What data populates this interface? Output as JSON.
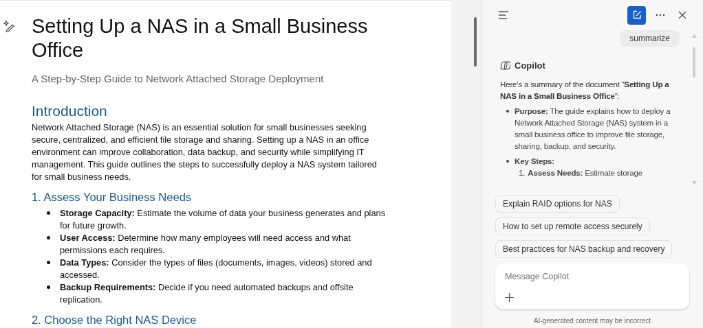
{
  "document": {
    "title": "Setting Up a NAS in a Small Business Office",
    "subtitle": "A Step-by-Step Guide to Network Attached Storage Deployment",
    "sections": [
      {
        "heading": "Introduction",
        "kind": "h1",
        "paragraph": "Network Attached Storage (NAS) is an essential solution for small businesses seeking secure, centralized, and efficient file storage and sharing. Setting up a NAS in an office environment can improve collaboration, data backup, and security while simplifying IT management. This guide outlines the steps to successfully deploy a NAS system tailored for small business needs."
      },
      {
        "heading": "1. Assess Your Business Needs",
        "kind": "h2",
        "bullets": [
          "**Storage Capacity:** Estimate the volume of data your business generates and plans for future growth.",
          "**User Access:** Determine how many employees will need access and what permissions each requires.",
          "**Data Types:** Consider the types of files (documents, images, videos) stored and accessed.",
          "**Backup Requirements:** Decide if you need automated backups and offsite replication."
        ]
      },
      {
        "heading": "2. Choose the Right NAS Device",
        "kind": "h2"
      }
    ]
  },
  "copilot": {
    "user_message": "summarize",
    "assistant_name": "Copilot",
    "summary_intro": "Here's a summary of the document “**Setting Up a NAS in a Small Business Office**”:",
    "summary_points": [
      {
        "text": "**Purpose:** The guide explains how to deploy a Network Attached Storage (NAS) system in a small business office to improve file storage, sharing, backup, and security."
      },
      {
        "text": "**Key Steps:**",
        "steps": [
          {
            "number": "1.",
            "text": "**Assess Needs:** Estimate storage"
          }
        ]
      }
    ],
    "suggestions": [
      "Explain RAID options for NAS",
      "How to set up remote access securely",
      "Best practices for NAS backup and recovery"
    ],
    "input": {
      "placeholder": "Message Copilot"
    },
    "disclaimer": "AI-generated content may be incorrect"
  }
}
